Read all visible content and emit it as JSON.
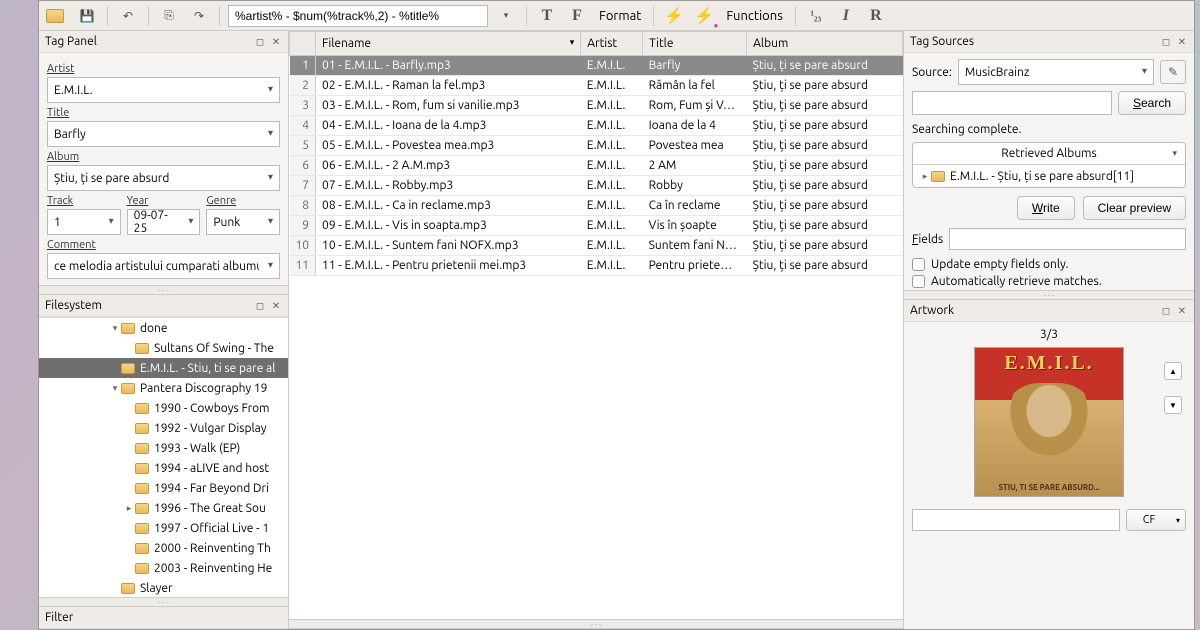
{
  "toolbar": {
    "pattern": "%artist% - $num(%track%,2) - %title%",
    "format_label": "Format",
    "functions_label": "Functions"
  },
  "tag_panel": {
    "title": "Tag Panel",
    "artist_label": "Artist",
    "artist": "E.M.I.L.",
    "title_label": "Title",
    "title_val": "Barfly",
    "album_label": "Album",
    "album": "Știu, ți se pare absurd",
    "track_label": "Track",
    "track": "1",
    "year_label": "Year",
    "year": "09-07-25",
    "genre_label": "Genre",
    "genre": "Punk",
    "comment_label": "Comment",
    "comment": "ce melodia artistului cumparati albumul."
  },
  "filesystem": {
    "title": "Filesystem",
    "nodes": [
      {
        "indent": 5,
        "exp": "▾",
        "label": "done"
      },
      {
        "indent": 6,
        "exp": "",
        "label": "Sultans Of Swing - The"
      },
      {
        "indent": 5,
        "exp": "",
        "label": "E.M.I.L. - Stiu, ti se pare al",
        "sel": true
      },
      {
        "indent": 5,
        "exp": "▾",
        "label": "Pantera Discography 19"
      },
      {
        "indent": 6,
        "exp": "",
        "label": "1990 - Cowboys From"
      },
      {
        "indent": 6,
        "exp": "",
        "label": "1992 - Vulgar Display"
      },
      {
        "indent": 6,
        "exp": "",
        "label": "1993 - Walk (EP)"
      },
      {
        "indent": 6,
        "exp": "",
        "label": "1994 - aLIVE and host"
      },
      {
        "indent": 6,
        "exp": "",
        "label": "1994 - Far Beyond Dri"
      },
      {
        "indent": 6,
        "exp": "▸",
        "label": "1996 - The Great Sou"
      },
      {
        "indent": 6,
        "exp": "",
        "label": "1997 - Official Live - 1"
      },
      {
        "indent": 6,
        "exp": "",
        "label": "2000 - Reinventing Th"
      },
      {
        "indent": 6,
        "exp": "",
        "label": "2003 - Reinventing He"
      },
      {
        "indent": 5,
        "exp": "",
        "label": "Slayer"
      }
    ]
  },
  "table": {
    "cols": [
      "Filename",
      "Artist",
      "Title",
      "Album"
    ],
    "rows": [
      {
        "n": 1,
        "file": "01 - E.M.I.L. - Barfly.mp3",
        "artist": "E.M.I.L.",
        "title": "Barfly",
        "album": "Știu, ți se pare absurd",
        "sel": true
      },
      {
        "n": 2,
        "file": "02 - E.M.I.L. - Raman la fel.mp3",
        "artist": "E.M.I.L.",
        "title": "Rămân la fel",
        "album": "Știu, ți se pare absurd"
      },
      {
        "n": 3,
        "file": "03 - E.M.I.L. - Rom, fum si vanilie.mp3",
        "artist": "E.M.I.L.",
        "title": "Rom, Fum și V…",
        "album": "Știu, ți se pare absurd"
      },
      {
        "n": 4,
        "file": "04 - E.M.I.L. - Ioana de la 4.mp3",
        "artist": "E.M.I.L.",
        "title": "Ioana de la 4",
        "album": "Știu, ți se pare absurd"
      },
      {
        "n": 5,
        "file": "05 - E.M.I.L. - Povestea mea.mp3",
        "artist": "E.M.I.L.",
        "title": "Povestea mea",
        "album": "Știu, ți se pare absurd"
      },
      {
        "n": 6,
        "file": "06 - E.M.I.L. - 2 A.M.mp3",
        "artist": "E.M.I.L.",
        "title": "2 AM",
        "album": "Știu, ți se pare absurd"
      },
      {
        "n": 7,
        "file": "07 - E.M.I.L. - Robby.mp3",
        "artist": "E.M.I.L.",
        "title": "Robby",
        "album": "Știu, ți se pare absurd"
      },
      {
        "n": 8,
        "file": "08 - E.M.I.L. - Ca in reclame.mp3",
        "artist": "E.M.I.L.",
        "title": "Ca în reclame",
        "album": "Știu, ți se pare absurd"
      },
      {
        "n": 9,
        "file": "09 - E.M.I.L. - Vis in soapta.mp3",
        "artist": "E.M.I.L.",
        "title": "Vis în șoapte",
        "album": "Știu, ți se pare absurd"
      },
      {
        "n": 10,
        "file": "10 - E.M.I.L. - Suntem fani NOFX.mp3",
        "artist": "E.M.I.L.",
        "title": "Suntem fani N…",
        "album": "Știu, ți se pare absurd"
      },
      {
        "n": 11,
        "file": "11 - E.M.I.L. - Pentru prietenii mei.mp3",
        "artist": "E.M.I.L.",
        "title": "Pentru priete…",
        "album": "Știu, ți se pare absurd"
      }
    ]
  },
  "tag_sources": {
    "title": "Tag Sources",
    "source_label": "Source:",
    "source": "MusicBrainz",
    "search_btn": "Search",
    "status": "Searching complete.",
    "retrieved_head": "Retrieved Albums",
    "retrieved_item": "E.M.I.L. - Știu, ți se pare absurd[11]",
    "write_btn": "Write",
    "clear_btn": "Clear preview",
    "fields_label": "Fields",
    "chk1": "Update empty fields only.",
    "chk2": "Automatically retrieve matches."
  },
  "artwork": {
    "title": "Artwork",
    "count": "3/3",
    "album_title": "E.M.I.L.",
    "album_sub": "STIU, TI SE PARE ABSURD...",
    "cf_label": "CF"
  },
  "filter": {
    "title": "Filter"
  }
}
